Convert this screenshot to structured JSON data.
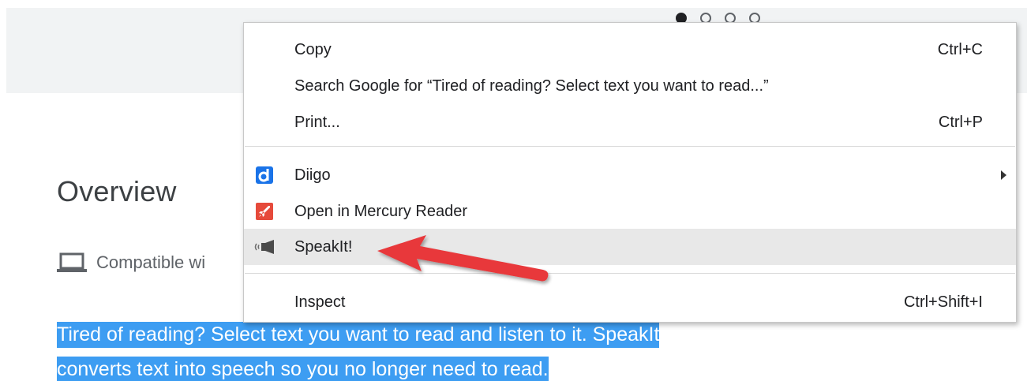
{
  "banner": {
    "carousel": {
      "count": 4,
      "active_index": 0
    }
  },
  "overview": {
    "title": "Overview",
    "compat_text": "Compatible wi",
    "desc_line1": "Tired of reading? Select text you want to read and listen to it. SpeakIt",
    "desc_line2": "converts text into speech so you no longer need to read."
  },
  "context_menu": {
    "items": [
      {
        "label": "Copy",
        "shortcut": "Ctrl+C"
      },
      {
        "label": "Search Google for “Tired of reading? Select text you want to read...”",
        "shortcut": ""
      },
      {
        "label": "Print...",
        "shortcut": "Ctrl+P"
      },
      {
        "label": "Diigo",
        "shortcut": "",
        "icon": "diigo-icon",
        "submenu": true
      },
      {
        "label": "Open in Mercury Reader",
        "shortcut": "",
        "icon": "mercury-rocket-icon"
      },
      {
        "label": "SpeakIt!",
        "shortcut": "",
        "icon": "speaker-icon",
        "highlighted": true
      },
      {
        "label": "Inspect",
        "shortcut": "Ctrl+Shift+I"
      }
    ]
  },
  "colors": {
    "selection": "#3d9df2",
    "arrow": "#e8373b",
    "diigo": "#1a73e8",
    "mercury": "#e64a3b",
    "menu_hover": "#e8e8e8"
  }
}
